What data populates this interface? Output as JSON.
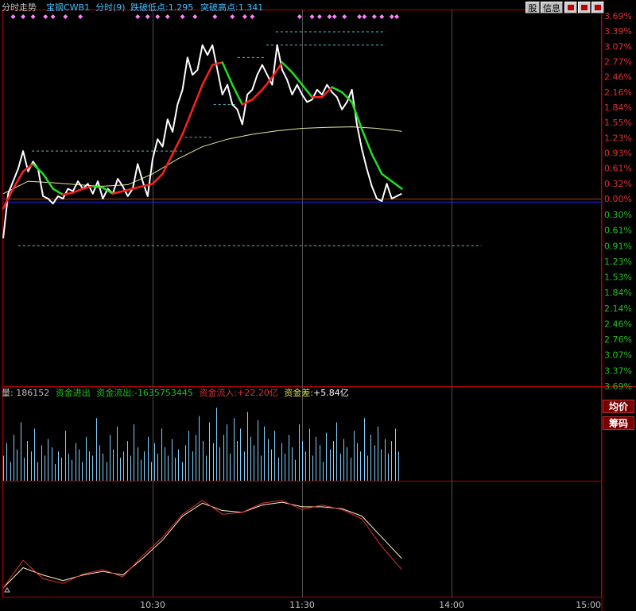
{
  "header": {
    "mode_label": "分时走势",
    "security_name": "宝钢CWB1",
    "period_label": "分时(9)",
    "break_low_label": "跌破低点:",
    "break_low_value": "1.295",
    "break_high_label": "突破高点:",
    "break_high_value": "1.341"
  },
  "toolbar": {
    "stock_btn": "股",
    "info_btn": "信息"
  },
  "side_buttons": {
    "avg_price": "均价",
    "chips": "筹码"
  },
  "volume_header": {
    "volume_label": "量:",
    "volume_value": "186152",
    "fund_flow_label": "资金进出",
    "fund_out_label": "资金流出:",
    "fund_out_value": "-1635753445",
    "fund_in_label": "资金流入:",
    "fund_in_value": "+22.20亿",
    "fund_diff_label": "资金差:",
    "fund_diff_value": "+5.84亿"
  },
  "colors": {
    "price_line": "#ffffff",
    "avg_line": "#e8e8a0",
    "ma_up": "#ff2020",
    "ma_down": "#20e020",
    "frame": "#b00000",
    "marker": "#ff80ff",
    "label_cyan": "#40c0ff",
    "label_green": "#20c020",
    "label_red": "#e03030",
    "label_yellow": "#e0e040",
    "vol_bar": "#80d0ff"
  },
  "chart_data": [
    {
      "type": "line",
      "title": "",
      "y_pct_ticks_upper": [
        "3.69%",
        "3.39%",
        "3.07%",
        "2.77%",
        "2.46%",
        "2.16%",
        "1.84%",
        "1.55%",
        "1.23%",
        "0.93%",
        "0.61%",
        "0.32%",
        "0.00%"
      ],
      "y_pct_ticks_lower": [
        "0.30%",
        "0.61%",
        "0.91%",
        "1.23%",
        "1.53%",
        "1.84%",
        "2.14%",
        "2.46%",
        "2.76%",
        "3.07%",
        "3.37%",
        "3.69%"
      ],
      "ylim_pct": [
        -3.69,
        3.69
      ],
      "x_ticks": [
        "10:30",
        "11:30",
        "14:00",
        "15:00"
      ],
      "support_line_pct": -0.06,
      "dashed_levels_pct": [
        -0.95,
        3.1
      ],
      "dashed_steps": [
        {
          "pct": 0.96,
          "from": 0.06,
          "to": 0.38
        },
        {
          "pct": 1.24,
          "from": 0.38,
          "to": 0.44
        },
        {
          "pct": 1.9,
          "from": 0.44,
          "to": 0.49
        },
        {
          "pct": 2.85,
          "from": 0.49,
          "to": 0.55
        },
        {
          "pct": 3.1,
          "from": 0.55,
          "to": 0.8
        },
        {
          "pct": 3.37,
          "from": 0.57,
          "to": 0.8
        }
      ],
      "series": [
        {
          "key": "price",
          "x": [
            0,
            2,
            4,
            6,
            8,
            10,
            12,
            14,
            16,
            18,
            20,
            22,
            24,
            26,
            28,
            30,
            32,
            34,
            36,
            38,
            40,
            42,
            44,
            46,
            48,
            50,
            52,
            54,
            56,
            58,
            60,
            62,
            64,
            66,
            68,
            70,
            72,
            74,
            76,
            78,
            80,
            82,
            84,
            86,
            88,
            90,
            92,
            94,
            96,
            98,
            100,
            102,
            104,
            106,
            108,
            110,
            112,
            114,
            116,
            118,
            120,
            122,
            124,
            126,
            128,
            130,
            132,
            134,
            136,
            138,
            140,
            142,
            144,
            146,
            148,
            150,
            152,
            154,
            156,
            158,
            160
          ],
          "y": [
            -0.8,
            0.1,
            0.35,
            0.6,
            0.96,
            0.55,
            0.75,
            0.6,
            0.05,
            0.0,
            -0.1,
            0.05,
            0.0,
            0.2,
            0.15,
            0.35,
            0.2,
            0.3,
            0.1,
            0.35,
            0.0,
            0.2,
            0.1,
            0.4,
            0.25,
            0.05,
            0.2,
            0.7,
            0.35,
            0.05,
            0.8,
            1.2,
            1.05,
            1.6,
            1.35,
            1.9,
            2.2,
            2.85,
            2.5,
            2.6,
            3.1,
            2.9,
            3.1,
            2.6,
            2.1,
            2.3,
            1.9,
            1.8,
            1.5,
            2.1,
            2.2,
            2.5,
            2.7,
            2.5,
            2.3,
            3.1,
            2.6,
            2.4,
            2.1,
            2.3,
            2.1,
            1.95,
            2.0,
            2.2,
            2.1,
            2.3,
            2.15,
            2.05,
            1.8,
            1.95,
            2.2,
            1.5,
            1.0,
            0.6,
            0.25,
            0.0,
            -0.05,
            0.3,
            0.0,
            0.05,
            0.1
          ]
        },
        {
          "key": "avg",
          "x": [
            0,
            10,
            20,
            30,
            40,
            50,
            60,
            70,
            80,
            90,
            100,
            110,
            120,
            130,
            140,
            150,
            160
          ],
          "y": [
            0.1,
            0.35,
            0.32,
            0.28,
            0.25,
            0.28,
            0.5,
            0.8,
            1.05,
            1.2,
            1.3,
            1.37,
            1.42,
            1.44,
            1.45,
            1.42,
            1.36
          ]
        },
        {
          "key": "ma",
          "x": [
            0,
            4,
            8,
            12,
            16,
            20,
            24,
            28,
            32,
            36,
            40,
            44,
            48,
            52,
            56,
            60,
            64,
            68,
            72,
            76,
            80,
            84,
            88,
            92,
            96,
            100,
            104,
            108,
            112,
            116,
            120,
            124,
            128,
            132,
            136,
            140,
            144,
            148,
            152,
            156,
            160
          ],
          "y": [
            -0.2,
            0.2,
            0.55,
            0.7,
            0.5,
            0.2,
            0.08,
            0.12,
            0.2,
            0.25,
            0.22,
            0.1,
            0.15,
            0.2,
            0.25,
            0.3,
            0.5,
            0.9,
            1.3,
            1.8,
            2.3,
            2.7,
            2.75,
            2.3,
            1.9,
            2.0,
            2.2,
            2.45,
            2.75,
            2.55,
            2.3,
            2.05,
            2.05,
            2.25,
            2.15,
            1.95,
            1.4,
            0.9,
            0.5,
            0.35,
            0.2
          ]
        }
      ],
      "up_markers_x": [
        4,
        8,
        12,
        17,
        20,
        25,
        31,
        54,
        58,
        62,
        66,
        72,
        77,
        85,
        92,
        97,
        100,
        119,
        124,
        127,
        131,
        133,
        137,
        143,
        145,
        149,
        152,
        156,
        158
      ],
      "down_markers_x": []
    },
    {
      "type": "bar",
      "title": "",
      "ylabel": "",
      "values": [
        12,
        18,
        9,
        22,
        15,
        28,
        11,
        19,
        14,
        25,
        9,
        17,
        12,
        20,
        16,
        8,
        14,
        11,
        24,
        13,
        10,
        18,
        15,
        9,
        21,
        14,
        12,
        30,
        17,
        13,
        9,
        22,
        15,
        26,
        11,
        14,
        19,
        12,
        27,
        16,
        10,
        14,
        21,
        9,
        18,
        13,
        25,
        16,
        12,
        20,
        11,
        15,
        9,
        17,
        24,
        14,
        22,
        31,
        19,
        12,
        28,
        18,
        35,
        16,
        22,
        27,
        13,
        30,
        19,
        25,
        14,
        33,
        21,
        17,
        29,
        12,
        26,
        20,
        15,
        24,
        11,
        18,
        13,
        22,
        16,
        10,
        27,
        19,
        14,
        25,
        12,
        21,
        17,
        9,
        23,
        15,
        19,
        28,
        13,
        20,
        16,
        11,
        24,
        18,
        14,
        30,
        12,
        22,
        17,
        26,
        15,
        20,
        13,
        19,
        25,
        14
      ],
      "ylim": [
        0,
        40
      ]
    },
    {
      "type": "line",
      "title": "",
      "series": [
        {
          "key": "fund_fast",
          "x": [
            0,
            8,
            16,
            24,
            32,
            40,
            48,
            56,
            64,
            72,
            80,
            88,
            96,
            104,
            112,
            120,
            128,
            136,
            144,
            152,
            160
          ],
          "y": [
            0.0,
            0.3,
            0.1,
            0.05,
            0.15,
            0.2,
            0.12,
            0.35,
            0.55,
            0.8,
            0.95,
            0.8,
            0.82,
            0.92,
            0.95,
            0.85,
            0.9,
            0.85,
            0.75,
            0.45,
            0.2
          ]
        },
        {
          "key": "fund_slow",
          "x": [
            0,
            8,
            16,
            24,
            32,
            40,
            48,
            56,
            64,
            72,
            80,
            88,
            96,
            104,
            112,
            120,
            128,
            136,
            144,
            152,
            160
          ],
          "y": [
            0.0,
            0.22,
            0.14,
            0.08,
            0.14,
            0.18,
            0.14,
            0.32,
            0.52,
            0.78,
            0.92,
            0.84,
            0.82,
            0.9,
            0.93,
            0.88,
            0.88,
            0.86,
            0.78,
            0.55,
            0.32
          ]
        }
      ],
      "ylim": [
        0,
        1
      ]
    }
  ]
}
